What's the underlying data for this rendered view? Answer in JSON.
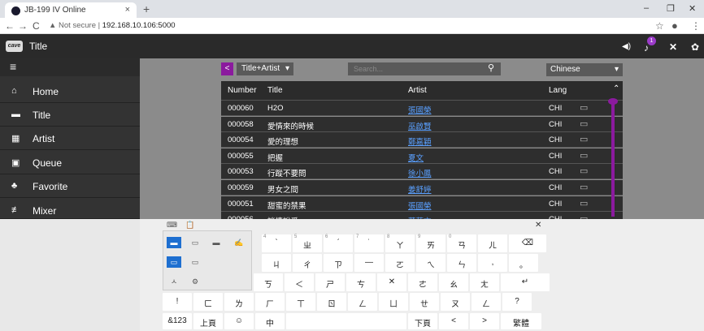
{
  "browser": {
    "tab_title": "JB-199 IV Online",
    "tab_close": "×",
    "new_tab": "+",
    "back": "←",
    "forward": "→",
    "reload": "C",
    "not_secure": "▲ Not secure",
    "url": "192.168.10.106:5000",
    "minimize": "–",
    "restore": "❐",
    "close": "✕",
    "star": "☆",
    "profile": "●",
    "more": "⋮"
  },
  "app": {
    "logo": "cave",
    "title": "Title",
    "badge": "1",
    "volume_icon": "◀)",
    "mic_icon": "♪",
    "expand_icon": "✕",
    "settings_icon": "✿"
  },
  "sidebar": {
    "menu_icon": "≡",
    "items": [
      {
        "icon": "⌂",
        "label": "Home"
      },
      {
        "icon": "▬",
        "label": "Title"
      },
      {
        "icon": "▦",
        "label": "Artist"
      },
      {
        "icon": "▣",
        "label": "Queue"
      },
      {
        "icon": "♣",
        "label": "Favorite"
      },
      {
        "icon": "≢",
        "label": "Mixer"
      }
    ]
  },
  "toolbar": {
    "back": "<",
    "mode": "Title+Artist",
    "mode_arrow": "▾",
    "search_placeholder": "Search...",
    "search_icon": "⚲",
    "language": "Chinese",
    "lang_arrow": "▾"
  },
  "table": {
    "headers": {
      "number": "Number",
      "title": "Title",
      "artist": "Artist",
      "lang": "Lang"
    },
    "sort_icon": "⌃",
    "screen_icon": "▭",
    "rows": [
      {
        "number": "000060",
        "title": "H2O",
        "artist": "張國榮",
        "lang": "CHI"
      },
      {
        "number": "000058",
        "title": "愛情來的時候",
        "artist": "巫啟賢",
        "lang": "CHI"
      },
      {
        "number": "000054",
        "title": "愛的理想",
        "artist": "鄭嘉穎",
        "lang": "CHI"
      },
      {
        "number": "000055",
        "title": "把握",
        "artist": "夏文",
        "lang": "CHI"
      },
      {
        "number": "000053",
        "title": "行蹤不要問",
        "artist": "徐小鳳",
        "lang": "CHI"
      },
      {
        "number": "000059",
        "title": "男女之間",
        "artist": "姜舒婷",
        "lang": "CHI"
      },
      {
        "number": "000051",
        "title": "甜蜜的禁果",
        "artist": "張國榮",
        "lang": "CHI"
      },
      {
        "number": "000056",
        "title": "談情說愛",
        "artist": "葉蒨文",
        "lang": "CHI"
      }
    ]
  },
  "keyboard": {
    "close": "✕",
    "top_icons": [
      "⌨",
      "📋"
    ],
    "row1": [
      {
        "n": "4",
        "g": "ˋ"
      },
      {
        "n": "5",
        "g": "ㄓ"
      },
      {
        "n": "6",
        "g": "ˊ"
      },
      {
        "n": "7",
        "g": "˙"
      },
      {
        "n": "8",
        "g": "ㄚ"
      },
      {
        "n": "9",
        "g": "ㄞ"
      },
      {
        "n": "0",
        "g": "ㄢ"
      },
      {
        "n": "",
        "g": "ㄦ"
      },
      {
        "n": "",
        "g": "⌫"
      }
    ],
    "row2": [
      {
        "g": "ㄐ"
      },
      {
        "g": "ㄔ"
      },
      {
        "g": "ㄗ"
      },
      {
        "g": "—"
      },
      {
        "g": "ㄛ"
      },
      {
        "g": "ㄟ"
      },
      {
        "g": "ㄣ"
      },
      {
        "g": ","
      },
      {
        "g": "。"
      }
    ],
    "row3": [
      {
        "g": "ㄎ"
      },
      {
        "g": "＜"
      },
      {
        "g": "ㄕ"
      },
      {
        "g": "ㄘ"
      },
      {
        "g": "✕"
      },
      {
        "g": "ㄜ"
      },
      {
        "g": "ㄠ"
      },
      {
        "g": "ㄤ"
      },
      {
        "g": "↵"
      }
    ],
    "row4": [
      {
        "g": "!"
      },
      {
        "g": "ㄈ"
      },
      {
        "g": "ㄌ"
      },
      {
        "g": "ㄏ"
      },
      {
        "g": "ㄒ"
      },
      {
        "g": "ㄖ"
      },
      {
        "g": "ㄥ"
      },
      {
        "g": "ㄩ"
      },
      {
        "g": "ㄝ"
      },
      {
        "g": "ㄡ"
      },
      {
        "g": "ㄥ"
      },
      {
        "g": "?"
      }
    ],
    "row5": {
      "numbers": "&123",
      "prev": "上頁",
      "emoji": "☺",
      "chinese": "中",
      "next": "下頁",
      "left": "<",
      "right": ">",
      "traditional": "繁體"
    },
    "panel": {
      "layout_a": "▬",
      "layout_b": "▭",
      "layout_c": "▬",
      "handwrite": "✍",
      "split_a": "▭",
      "split_b": "▭",
      "ink": "ㅅ",
      "gear": "⚙"
    }
  }
}
